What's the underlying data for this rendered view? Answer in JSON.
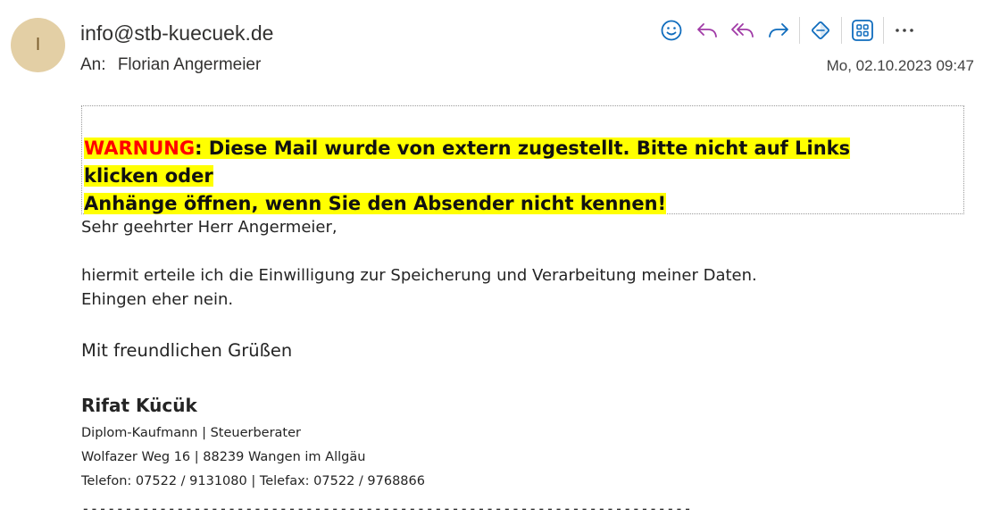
{
  "header": {
    "avatar_initial": "I",
    "sender": "info@stb-kuecuek.de",
    "to_label": "An:",
    "recipient": "Florian Angermeier",
    "date": "Mo, 02.10.2023 09:47"
  },
  "toolbar": {
    "icons": [
      "emoji-icon",
      "reply-icon",
      "reply-all-icon",
      "forward-icon",
      "sticky-note-icon",
      "apps-icon",
      "more-icon"
    ]
  },
  "warning": {
    "prefix": "WARNUNG",
    "line1": ": Diese Mail wurde von extern zugestellt. Bitte nicht auf Links klicken oder",
    "line2": "Anhänge öffnen, wenn Sie den Absender nicht kennen!"
  },
  "body": {
    "greeting": "Sehr geehrter Herr Angermeier,",
    "line1": "hiermit erteile ich die Einwilligung zur Speicherung und Verarbeitung meiner Daten.",
    "line2": "Ehingen eher nein.",
    "closing": "Mit freundlichen Grüßen"
  },
  "signature": {
    "name": "Rifat Kücük",
    "title": "Diplom-Kaufmann | Steuerberater",
    "address": "Wolfazer Weg 16 | 88239 Wangen im Allgäu",
    "phone": "Telefon: 07522 / 9131080 | Telefax: 07522 / 9768866",
    "divider": "-----------------------------------------------------------------------"
  },
  "colors": {
    "accent_blue": "#0f6cbd",
    "accent_purple": "#a03aa6",
    "warning_highlight": "#ffff00",
    "warning_red": "#ff0000",
    "avatar_bg": "#e3cfa5"
  }
}
